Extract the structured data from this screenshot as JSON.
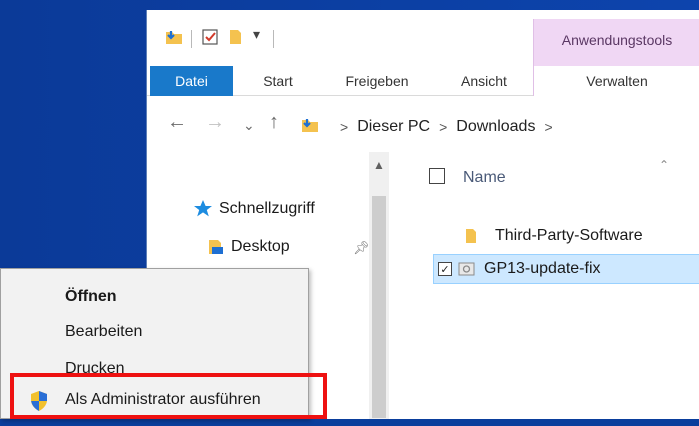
{
  "ribbon": {
    "contextual_group": "Anwendungstools",
    "tabs": {
      "file": "Datei",
      "start": "Start",
      "share": "Freigeben",
      "view": "Ansicht",
      "manage": "Verwalten"
    }
  },
  "address_bar": {
    "breadcrumbs": [
      "Dieser PC",
      "Downloads"
    ]
  },
  "nav_pane": {
    "quick_access": "Schnellzugriff",
    "desktop": "Desktop"
  },
  "file_list": {
    "column_name": "Name",
    "rows": [
      {
        "name": "Third-Party-Software",
        "type": "folder",
        "selected": false
      },
      {
        "name": "GP13-update-fix",
        "type": "file",
        "selected": true
      }
    ]
  },
  "context_menu": {
    "items": [
      {
        "label": "Öffnen",
        "bold": true
      },
      {
        "label": "Bearbeiten",
        "bold": false
      },
      {
        "label": "Drucken",
        "bold": false
      },
      {
        "label": "Als Administrator ausführen",
        "bold": false,
        "icon": "uac-shield-icon"
      }
    ]
  },
  "colors": {
    "file_tab": "#1979ca",
    "contextual_tab": "#f0d7f4",
    "selection": "#cde8ff",
    "highlight": "#ee1111",
    "desktop": "#0b3a98"
  }
}
